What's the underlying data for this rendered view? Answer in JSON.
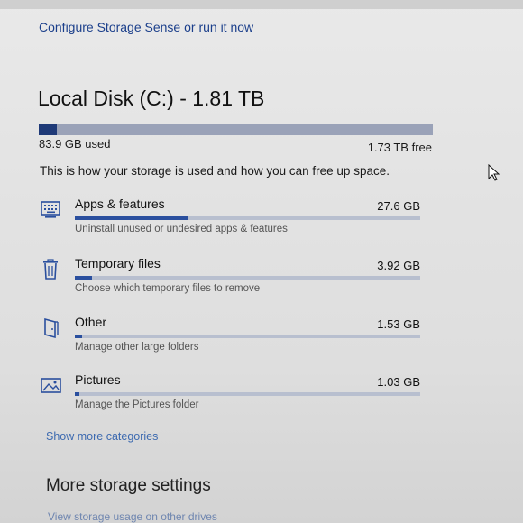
{
  "header": {
    "storage_sense_link": "Configure Storage Sense or run it now"
  },
  "disk": {
    "title": "Local Disk (C:) - 1.81 TB",
    "used_label": "83.9 GB used",
    "free_label": "1.73 TB free",
    "used_fraction": 0.045,
    "intro": "This is how your storage is used and how you can free up space."
  },
  "categories": [
    {
      "name": "Apps & features",
      "size": "27.6 GB",
      "description": "Uninstall unused or undesired apps & features",
      "fill_fraction": 0.33,
      "icon": "keyboard-icon"
    },
    {
      "name": "Temporary files",
      "size": "3.92 GB",
      "description": "Choose which temporary files to remove",
      "fill_fraction": 0.05,
      "icon": "trash-icon"
    },
    {
      "name": "Other",
      "size": "1.53 GB",
      "description": "Manage other large folders",
      "fill_fraction": 0.02,
      "icon": "door-icon"
    },
    {
      "name": "Pictures",
      "size": "1.03 GB",
      "description": "Manage the Pictures folder",
      "fill_fraction": 0.012,
      "icon": "picture-icon"
    }
  ],
  "links": {
    "show_more": "Show more categories",
    "other_drives": "View storage usage on other drives"
  },
  "more_settings_title": "More storage settings",
  "colors": {
    "accent": "#2a4f9e",
    "link": "#1b3f8b",
    "bar_track": "#b8bfcf"
  }
}
